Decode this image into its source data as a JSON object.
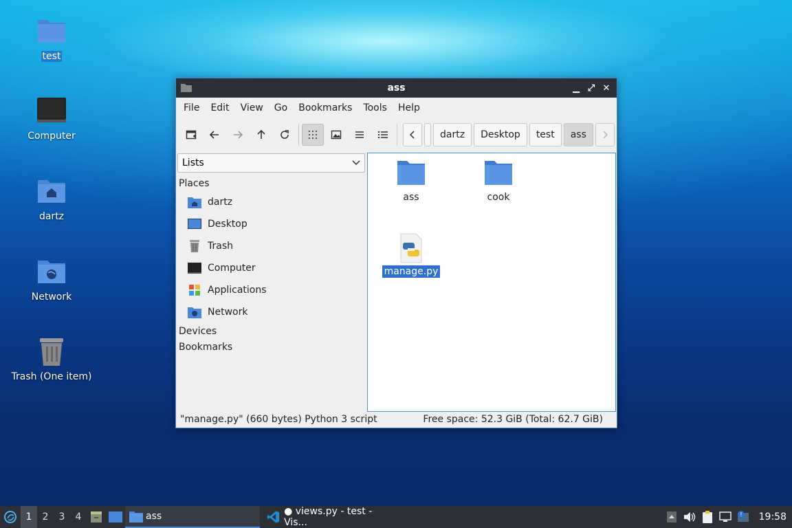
{
  "desktop": {
    "icons": [
      {
        "label": "test",
        "icon": "folder-icon",
        "selected": true
      },
      {
        "label": "Computer",
        "icon": "computer-icon"
      },
      {
        "label": "dartz",
        "icon": "home-folder-icon"
      },
      {
        "label": "Network",
        "icon": "network-folder-icon"
      },
      {
        "label": "Trash (One item)",
        "icon": "trash-icon"
      }
    ]
  },
  "window": {
    "title": "ass",
    "menu": [
      "File",
      "Edit",
      "View",
      "Go",
      "Bookmarks",
      "Tools",
      "Help"
    ],
    "breadcrumbs": [
      "dartz",
      "Desktop",
      "test",
      "ass"
    ],
    "sidebar": {
      "combo_value": "Lists",
      "places_header": "Places",
      "places": [
        {
          "label": "dartz",
          "icon": "home-folder-icon"
        },
        {
          "label": "Desktop",
          "icon": "desktop-icon"
        },
        {
          "label": "Trash",
          "icon": "trash-icon"
        },
        {
          "label": "Computer",
          "icon": "computer-icon"
        },
        {
          "label": "Applications",
          "icon": "applications-icon"
        },
        {
          "label": "Network",
          "icon": "network-icon"
        }
      ],
      "devices_header": "Devices",
      "bookmarks_header": "Bookmarks"
    },
    "files": [
      {
        "name": "ass",
        "type": "folder"
      },
      {
        "name": "cook",
        "type": "folder"
      },
      {
        "name": "manage.py",
        "type": "python-file",
        "selected": true
      }
    ],
    "status_left": "\"manage.py\" (660 bytes) Python 3 script",
    "status_right": "Free space: 52.3 GiB (Total: 62.7 GiB)"
  },
  "taskbar": {
    "workspaces": [
      "1",
      "2",
      "3",
      "4"
    ],
    "active_workspace": "1",
    "tasks": [
      {
        "label": "ass",
        "icon": "folder-icon",
        "active": true
      },
      {
        "label": "● views.py - test - Vis...",
        "icon": "vscode-icon"
      }
    ],
    "clock": "19:58"
  },
  "colors": {
    "accent": "#2f6fcf",
    "folder": "#4a86d8",
    "taskbar": "#2c2f36",
    "titlebar": "#2b2f35"
  }
}
